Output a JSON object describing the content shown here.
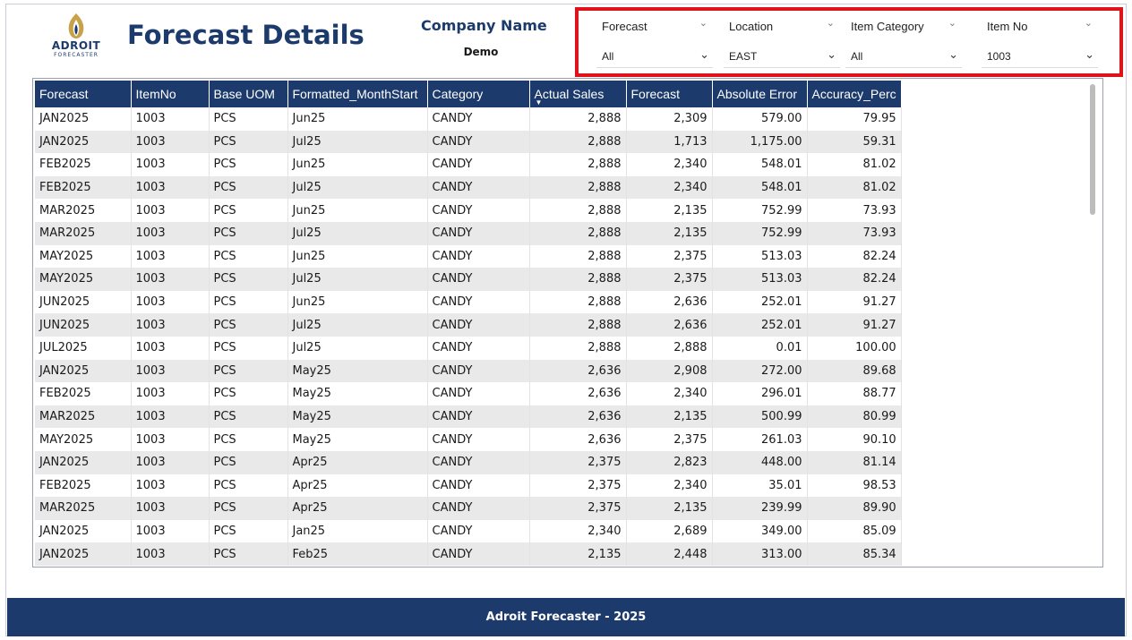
{
  "logo": {
    "word": "ADROIT",
    "sub": "FORECASTER"
  },
  "header": {
    "title": "Forecast Details",
    "company_label": "Company Name",
    "company_value": "Demo"
  },
  "filters": [
    {
      "label": "Forecast",
      "value": "All"
    },
    {
      "label": "Location",
      "value": "EAST"
    },
    {
      "label": "Item Category",
      "value": "All"
    },
    {
      "label": "Item No",
      "value": "1003"
    }
  ],
  "table": {
    "columns": [
      "Forecast",
      "ItemNo",
      "Base UOM",
      "Formatted_MonthStart",
      "Category",
      "Actual Sales",
      "Forecast",
      "Absolute Error",
      "Accuracy_Perc"
    ],
    "rows": [
      [
        "JAN2025",
        "1003",
        "PCS",
        "Jun25",
        "CANDY",
        "2,888",
        "2,309",
        "579.00",
        "79.95"
      ],
      [
        "JAN2025",
        "1003",
        "PCS",
        "Jul25",
        "CANDY",
        "2,888",
        "1,713",
        "1,175.00",
        "59.31"
      ],
      [
        "FEB2025",
        "1003",
        "PCS",
        "Jun25",
        "CANDY",
        "2,888",
        "2,340",
        "548.01",
        "81.02"
      ],
      [
        "FEB2025",
        "1003",
        "PCS",
        "Jul25",
        "CANDY",
        "2,888",
        "2,340",
        "548.01",
        "81.02"
      ],
      [
        "MAR2025",
        "1003",
        "PCS",
        "Jun25",
        "CANDY",
        "2,888",
        "2,135",
        "752.99",
        "73.93"
      ],
      [
        "MAR2025",
        "1003",
        "PCS",
        "Jul25",
        "CANDY",
        "2,888",
        "2,135",
        "752.99",
        "73.93"
      ],
      [
        "MAY2025",
        "1003",
        "PCS",
        "Jun25",
        "CANDY",
        "2,888",
        "2,375",
        "513.03",
        "82.24"
      ],
      [
        "MAY2025",
        "1003",
        "PCS",
        "Jul25",
        "CANDY",
        "2,888",
        "2,375",
        "513.03",
        "82.24"
      ],
      [
        "JUN2025",
        "1003",
        "PCS",
        "Jun25",
        "CANDY",
        "2,888",
        "2,636",
        "252.01",
        "91.27"
      ],
      [
        "JUN2025",
        "1003",
        "PCS",
        "Jul25",
        "CANDY",
        "2,888",
        "2,636",
        "252.01",
        "91.27"
      ],
      [
        "JUL2025",
        "1003",
        "PCS",
        "Jul25",
        "CANDY",
        "2,888",
        "2,888",
        "0.01",
        "100.00"
      ],
      [
        "JAN2025",
        "1003",
        "PCS",
        "May25",
        "CANDY",
        "2,636",
        "2,908",
        "272.00",
        "89.68"
      ],
      [
        "FEB2025",
        "1003",
        "PCS",
        "May25",
        "CANDY",
        "2,636",
        "2,340",
        "296.01",
        "88.77"
      ],
      [
        "MAR2025",
        "1003",
        "PCS",
        "May25",
        "CANDY",
        "2,636",
        "2,135",
        "500.99",
        "80.99"
      ],
      [
        "MAY2025",
        "1003",
        "PCS",
        "May25",
        "CANDY",
        "2,636",
        "2,375",
        "261.03",
        "90.10"
      ],
      [
        "JAN2025",
        "1003",
        "PCS",
        "Apr25",
        "CANDY",
        "2,375",
        "2,823",
        "448.00",
        "81.14"
      ],
      [
        "FEB2025",
        "1003",
        "PCS",
        "Apr25",
        "CANDY",
        "2,375",
        "2,340",
        "35.01",
        "98.53"
      ],
      [
        "MAR2025",
        "1003",
        "PCS",
        "Apr25",
        "CANDY",
        "2,375",
        "2,135",
        "239.99",
        "89.90"
      ],
      [
        "JAN2025",
        "1003",
        "PCS",
        "Jan25",
        "CANDY",
        "2,340",
        "2,689",
        "349.00",
        "85.09"
      ],
      [
        "JAN2025",
        "1003",
        "PCS",
        "Feb25",
        "CANDY",
        "2,135",
        "2,448",
        "313.00",
        "85.34"
      ]
    ]
  },
  "footer": {
    "text": "Adroit Forecaster - 2025"
  },
  "colors": {
    "brand": "#1c3a6b",
    "highlight": "#e0131b",
    "row_alt": "#e9e9e9",
    "logo_gold": "#c8a24a"
  }
}
